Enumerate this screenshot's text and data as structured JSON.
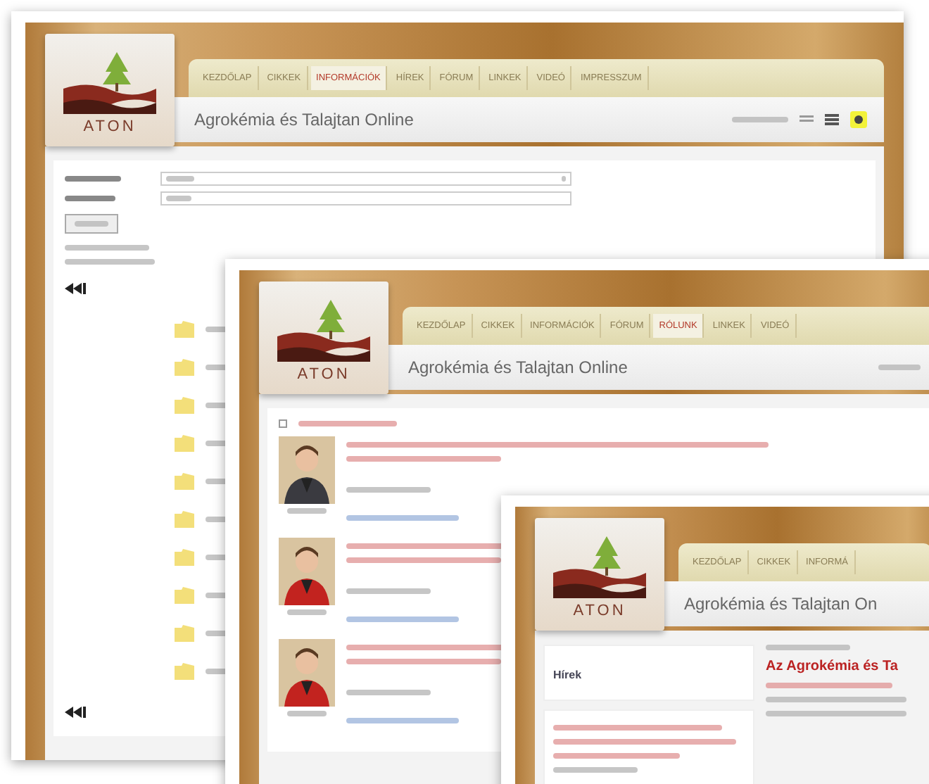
{
  "windows": [
    {
      "kind": "search",
      "logo": "ATON",
      "title": "Agrokémia és Talajtan Online",
      "tabs": [
        {
          "label": "KEZDŐLAP",
          "selected": false
        },
        {
          "label": "CIKKEK",
          "selected": false
        },
        {
          "label": "INFORMÁCIÓK",
          "selected": true
        },
        {
          "label": "HÍREK",
          "selected": false
        },
        {
          "label": "FÓRUM",
          "selected": false
        },
        {
          "label": "LINKEK",
          "selected": false
        },
        {
          "label": "VIDEÓ",
          "selected": false
        },
        {
          "label": "IMPRESSZUM",
          "selected": false
        }
      ]
    },
    {
      "kind": "forum",
      "logo": "ATON",
      "filter_checked": false,
      "title": "Agrokémia és Talajtan Online",
      "tabs": [
        {
          "label": "KEZDŐLAP",
          "selected": false
        },
        {
          "label": "CIKKEK",
          "selected": false
        },
        {
          "label": "INFORMÁCIÓK",
          "selected": false
        },
        {
          "label": "FÓRUM",
          "selected": false
        },
        {
          "label": "RÓLUNK",
          "selected": true
        },
        {
          "label": "LINKEK",
          "selected": false
        },
        {
          "label": "VIDEÓ",
          "selected": false
        }
      ]
    },
    {
      "kind": "news",
      "logo": "ATON",
      "title": "Agrokémia és Talajtan On",
      "tabs": [
        {
          "label": "KEZDŐLAP",
          "selected": false
        },
        {
          "label": "CIKKEK",
          "selected": false
        },
        {
          "label": "INFORMÁ",
          "selected": false
        }
      ],
      "box_title": "Hírek",
      "headline": "Az Agrokémia és Ta"
    }
  ]
}
